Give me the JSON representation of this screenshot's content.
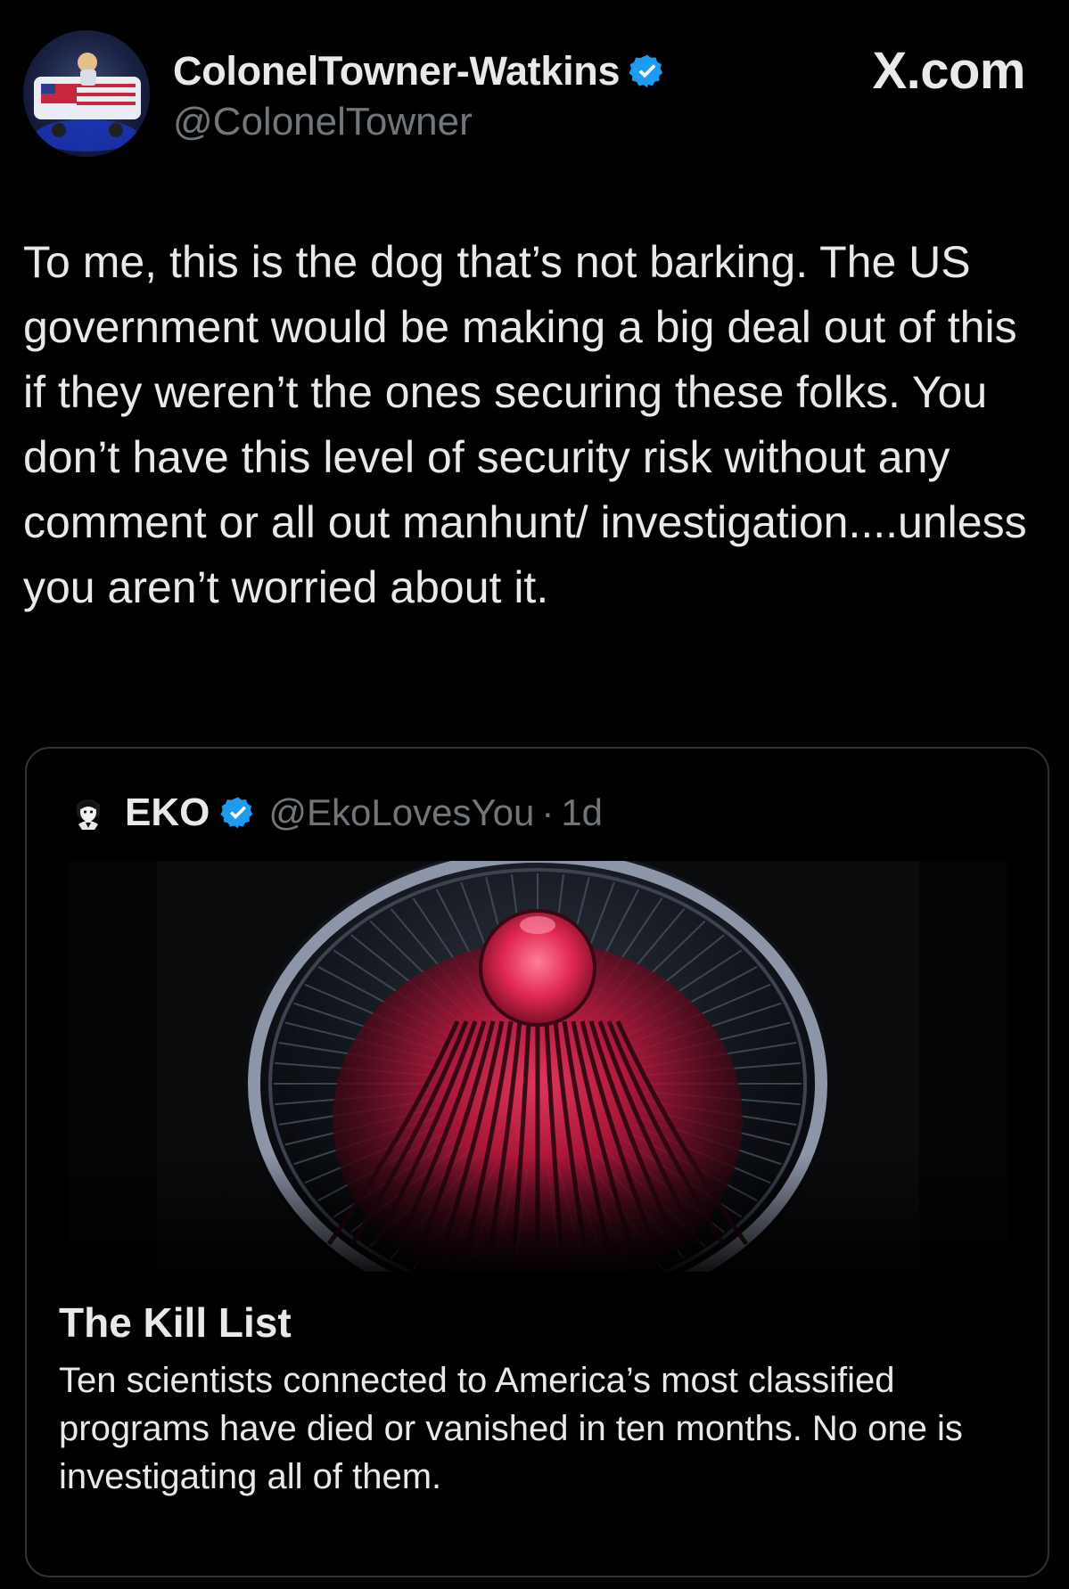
{
  "brand": "X.com",
  "author": {
    "display_name": "ColonelTowner-Watkins",
    "handle": "@ColonelTowner",
    "verified": true,
    "badge_color": "#1d9bf0"
  },
  "post": {
    "text": "To me, this is the dog that’s not barking. The US government would be making a big deal out of this if they weren’t the ones securing these folks. You don’t have this level of security risk without any comment or all out manhunt/ investigation....unless you aren’t worried about it."
  },
  "quoted_post": {
    "author_name": "EKO",
    "handle": "@EkoLovesYou",
    "separator": "·",
    "time": "1d",
    "verified": true,
    "card": {
      "title": "The Kill List",
      "description": "Ten scientists connected to America’s most classified programs have died or vanished in ten months. No one is investigating all of them."
    }
  },
  "colors": {
    "background": "#000000",
    "text_primary": "#e7e9ea",
    "text_secondary": "#71767b",
    "border": "#2f3336",
    "accent": "#1d9bf0",
    "media_red": "#d6224a"
  },
  "icons": {
    "verified": "verified-badge-icon",
    "avatar": "profile-avatar",
    "quote_avatar": "profile-avatar-small",
    "media": "article-hero-image"
  }
}
